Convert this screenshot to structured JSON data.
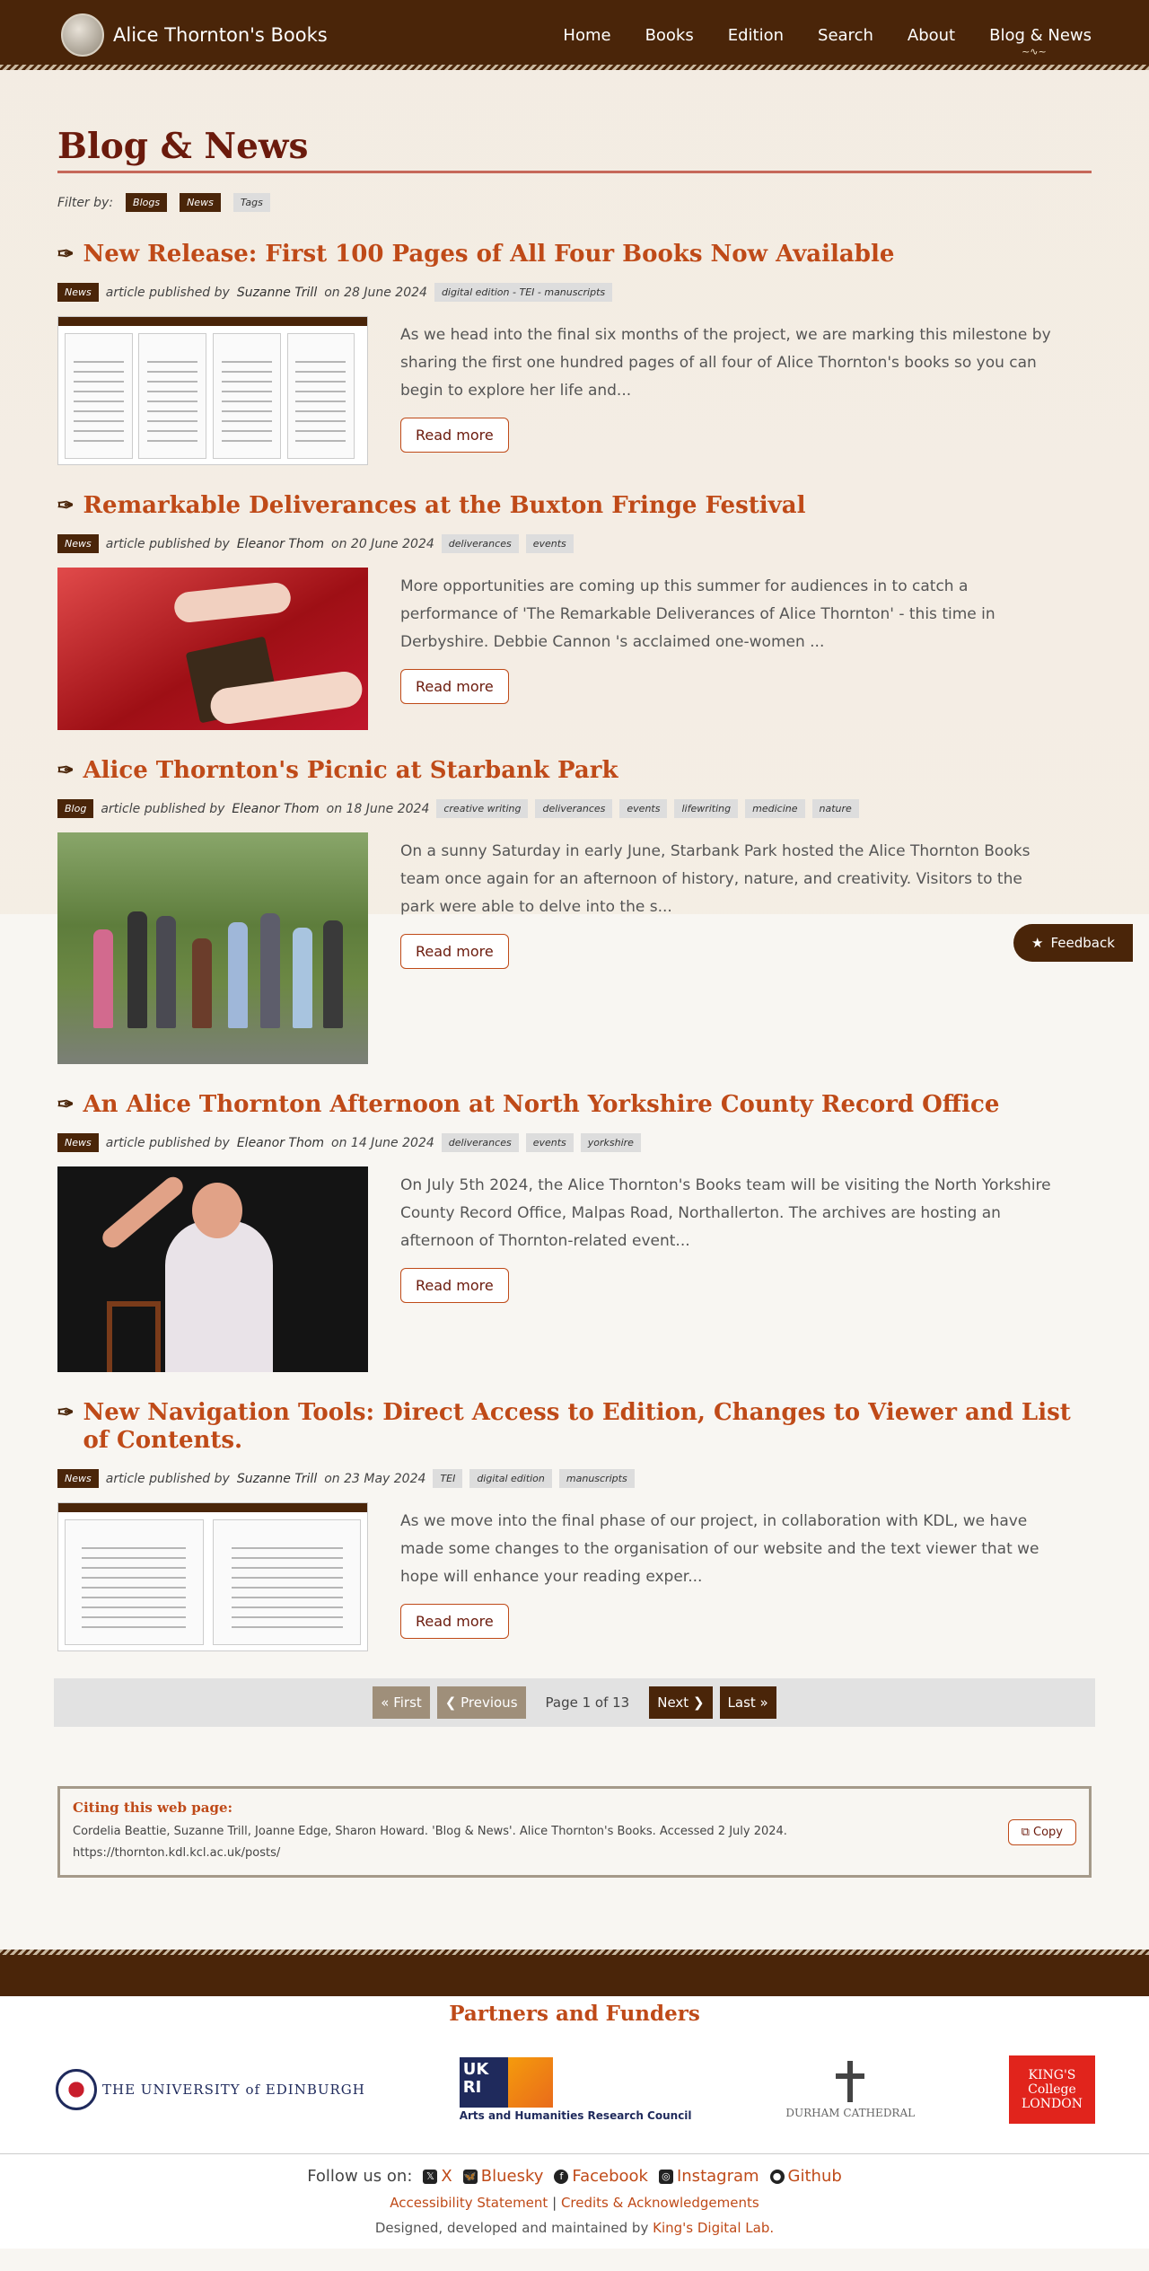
{
  "header": {
    "site_title": "Alice Thornton's Books",
    "nav": [
      {
        "label": "Home"
      },
      {
        "label": "Books"
      },
      {
        "label": "Edition"
      },
      {
        "label": "Search"
      },
      {
        "label": "About"
      },
      {
        "label": "Blog & News"
      }
    ],
    "active_nav": "Blog & News"
  },
  "page": {
    "title": "Blog & News",
    "filter_label": "Filter by:",
    "filters": [
      "Blogs",
      "News",
      "Tags"
    ]
  },
  "posts": [
    {
      "title": "New Release: First 100 Pages of All Four Books Now Available",
      "type": "News",
      "meta_prefix": "article published by",
      "author": "Suzanne Trill",
      "date_text": "on 28 June 2024",
      "tags": [
        "digital edition - TEI - manuscripts"
      ],
      "excerpt": "As we head into the final six months of the project, we are marking this milestone by sharing the first one hundred pages of all four of Alice Thornton's books so you can begin to explore her life and...",
      "read_more": "Read more",
      "image": "screens"
    },
    {
      "title": "Remarkable Deliverances at the Buxton Fringe Festival",
      "type": "News",
      "meta_prefix": "article published by",
      "author": "Eleanor Thom",
      "date_text": "on 20 June 2024",
      "tags": [
        "deliverances",
        "events"
      ],
      "excerpt": "More opportunities are coming up this summer for audiences in to catch a performance of 'The Remarkable Deliverances of Alice Thornton' - this time in Derbyshire. Debbie Cannon 's acclaimed one-women ...",
      "read_more": "Read more",
      "image": "red"
    },
    {
      "title": "Alice Thornton's Picnic at Starbank Park",
      "type": "Blog",
      "meta_prefix": "article published by",
      "author": "Eleanor Thom",
      "date_text": "on 18 June 2024",
      "tags": [
        "creative writing",
        "deliverances",
        "events",
        "lifewriting",
        "medicine",
        "nature"
      ],
      "excerpt": "On a sunny Saturday in early June, Starbank Park hosted the Alice Thornton Books team once again for an afternoon of history, nature, and creativity. Visitors to the park were able to delve into the s...",
      "read_more": "Read more",
      "image": "park"
    },
    {
      "title": "An Alice Thornton Afternoon at North Yorkshire County Record Office",
      "type": "News",
      "meta_prefix": "article published by",
      "author": "Eleanor Thom",
      "date_text": "on 14 June 2024",
      "tags": [
        "deliverances",
        "events",
        "yorkshire"
      ],
      "excerpt": "On July 5th 2024, the Alice Thornton's Books team will be visiting the North Yorkshire County Record Office, Malpas Road, Northallerton. The archives are hosting an afternoon of Thornton-related event...",
      "read_more": "Read more",
      "image": "stage"
    },
    {
      "title": "New Navigation Tools: Direct Access to Edition, Changes to Viewer and List of Contents.",
      "type": "News",
      "meta_prefix": "article published by",
      "author": "Suzanne Trill",
      "date_text": "on 23 May 2024",
      "tags": [
        "TEI",
        "digital edition",
        "manuscripts"
      ],
      "excerpt": "As we move into the final phase of our project, in collaboration with KDL, we have made some changes to the organisation of our website and the text viewer that we hope will enhance your reading exper...",
      "read_more": "Read more",
      "image": "screens2"
    }
  ],
  "pagination": {
    "first": "« First",
    "previous": "❮ Previous",
    "status": "Page 1 of 13",
    "next": "Next ❯",
    "last": "Last »"
  },
  "citation": {
    "title": "Citing this web page:",
    "text": "Cordelia Beattie, Suzanne Trill, Joanne Edge, Sharon Howard. 'Blog & News'. Alice Thornton's Books. Accessed 2 July 2024.",
    "url": "https://thornton.kdl.kcl.ac.uk/posts/",
    "copy_label": "Copy"
  },
  "feedback": {
    "label": "Feedback"
  },
  "footer": {
    "partners_title": "Partners and Funders",
    "partners": {
      "uoe": "THE UNIVERSITY of EDINBURGH",
      "ukri_mark": "UK RI",
      "ukri_text": "Arts and Humanities Research Council",
      "durham": "DURHAM CATHEDRAL",
      "kcl": "KING'S College LONDON"
    },
    "follow_label": "Follow us on:",
    "social": [
      {
        "label": "X",
        "icon": "x-icon"
      },
      {
        "label": "Bluesky",
        "icon": "bluesky-icon"
      },
      {
        "label": "Facebook",
        "icon": "facebook-icon"
      },
      {
        "label": "Instagram",
        "icon": "instagram-icon"
      },
      {
        "label": "Github",
        "icon": "github-icon"
      }
    ],
    "accessibility": "Accessibility Statement",
    "separator": "|",
    "credits": "Credits & Acknowledgements",
    "designed_prefix": "Designed, developed and maintained by",
    "kdl": "King's Digital Lab."
  },
  "colors": {
    "brand_dark": "#4a2509",
    "accent": "#bf4a18",
    "title": "#6b1a0c"
  }
}
